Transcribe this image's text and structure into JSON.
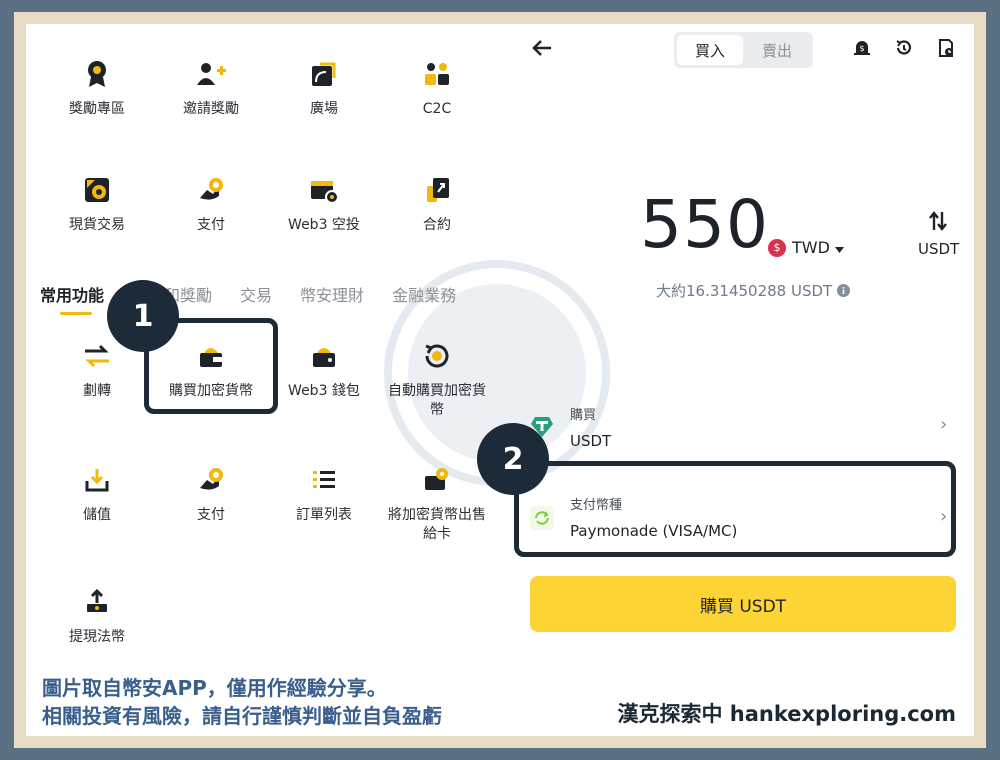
{
  "grid": [
    {
      "label": "獎勵專區",
      "icon": "badge-award-icon"
    },
    {
      "label": "邀請獎勵",
      "icon": "invite-user-icon"
    },
    {
      "label": "廣場",
      "icon": "square-feed-icon"
    },
    {
      "label": "C2C",
      "icon": "c2c-users-icon"
    },
    {
      "label": "現貨交易",
      "icon": "spot-trade-icon"
    },
    {
      "label": "支付",
      "icon": "pay-icon"
    },
    {
      "label": "Web3 空投",
      "icon": "airdrop-calendar-icon"
    },
    {
      "label": "合約",
      "icon": "futures-icon"
    }
  ],
  "tabs": [
    "常用功能",
    "活動和獎勵",
    "交易",
    "幣安理財",
    "金融業務"
  ],
  "common": [
    {
      "label": "劃轉",
      "icon": "transfer-icon"
    },
    {
      "label": "購買加密貨幣",
      "icon": "buy-crypto-wallet-icon"
    },
    {
      "label": "Web3 錢包",
      "icon": "web3-wallet-icon"
    },
    {
      "label": "自動購買加密貨幣",
      "icon": "auto-buy-icon"
    },
    {
      "label": "儲值",
      "icon": "deposit-icon"
    },
    {
      "label": "支付",
      "icon": "pay-icon"
    },
    {
      "label": "訂單列表",
      "icon": "order-list-icon"
    },
    {
      "label": "將加密貨幣出售給卡",
      "icon": "sell-to-card-icon"
    },
    {
      "label": "提現法幣",
      "icon": "withdraw-fiat-icon"
    }
  ],
  "badges": {
    "one": "1",
    "two": "2"
  },
  "buy_screen": {
    "toggle_buy": "買入",
    "toggle_sell": "賣出",
    "amount": "550",
    "fiat": "TWD",
    "fiat_symbol": "$",
    "crypto_toggle": "USDT",
    "approx": "大約16.31450288 USDT",
    "buy_row_label": "購買",
    "buy_row_value": "USDT",
    "pay_row_label": "支付幣種",
    "pay_row_value": "Paymonade (VISA/MC)",
    "buy_button": "購買 USDT"
  },
  "footer": {
    "note_line1": "圖片取自幣安APP，僅用作經驗分享。",
    "note_line2": "相關投資有風險，請自行謹慎判斷並自負盈虧",
    "brand": "漢克探索中 hankexploring.com"
  },
  "colors": {
    "accent": "#f0b90b",
    "button": "#fcd535",
    "dark": "#1d2a38",
    "note": "#3a5f8c"
  }
}
